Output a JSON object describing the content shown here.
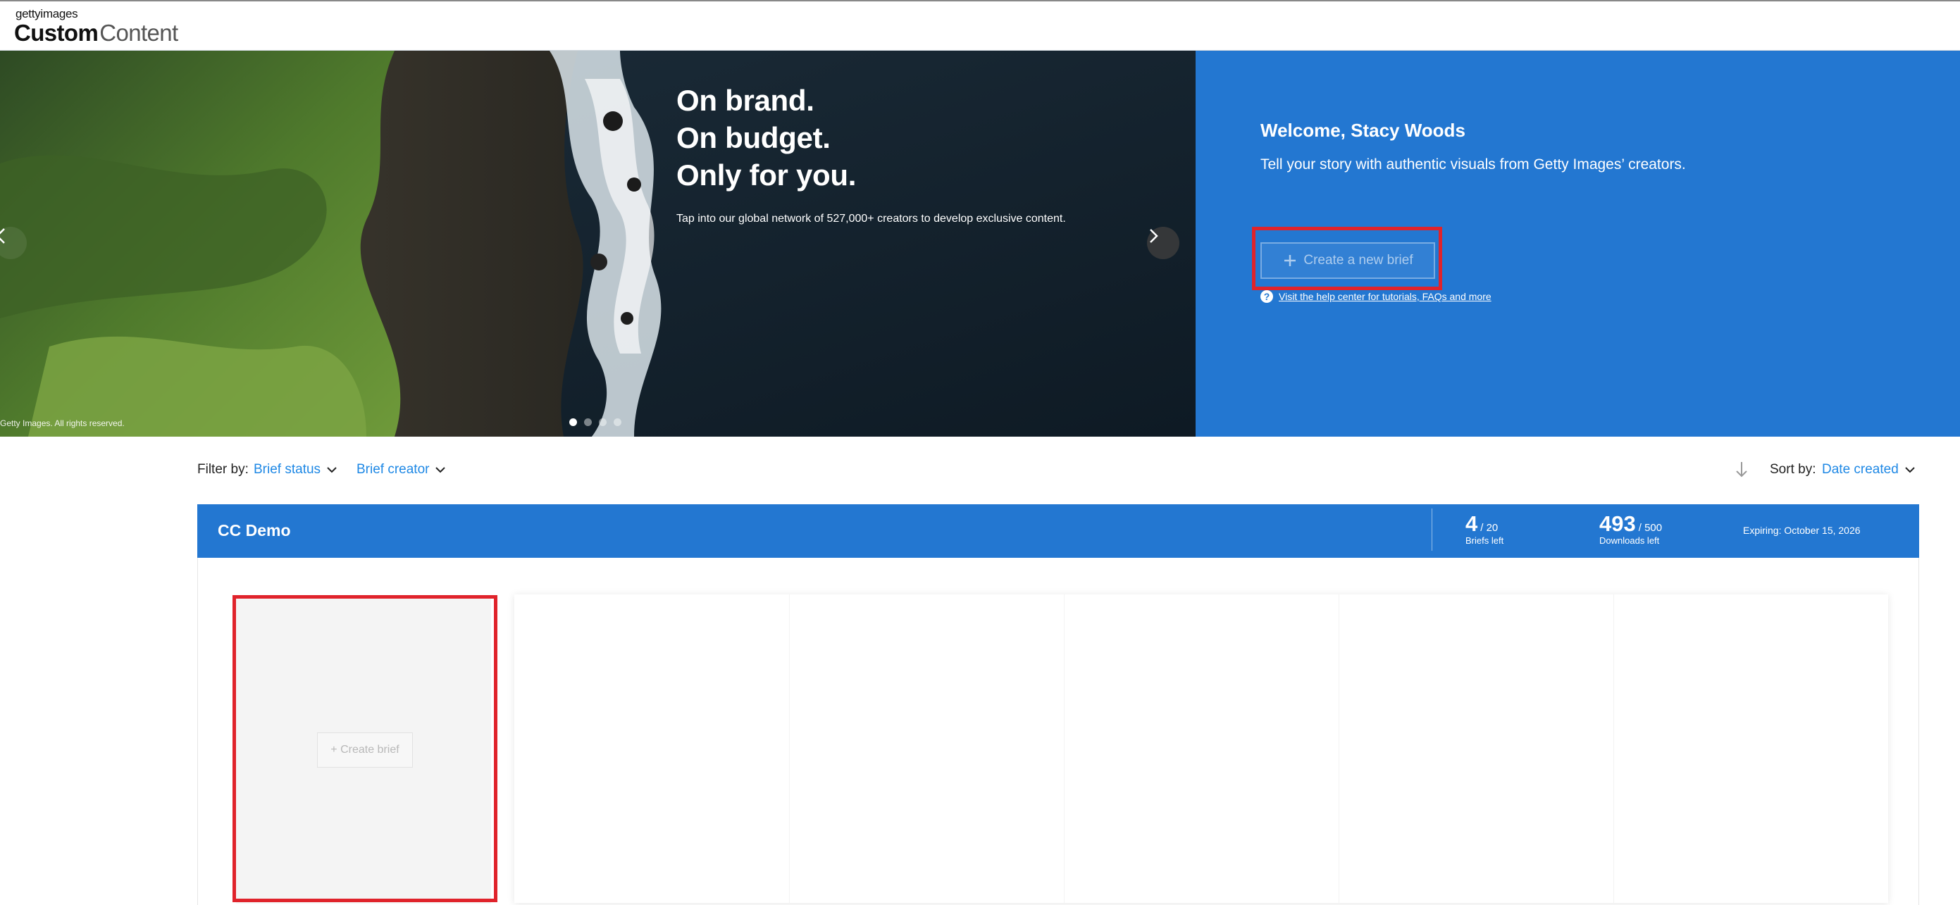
{
  "header": {
    "logo_brand": "gettyimages",
    "logo_title_part1": "Custom",
    "logo_title_part2": "Content"
  },
  "hero": {
    "headline_lines": [
      "On brand.",
      "On budget.",
      "Only for you."
    ],
    "tagline": "Tap into our global network of 527,000+ creators to develop exclusive content.",
    "copyright": "Getty Images. All rights reserved.",
    "welcome": "Welcome, Stacy Woods",
    "welcome_sub": "Tell your story with authentic visuals from Getty Images’ creators.",
    "create_button_label": "Create a new brief",
    "help_link": "Visit the help center for tutorials, FAQs and more"
  },
  "filters": {
    "filter_label": "Filter by:",
    "brief_status": "Brief status",
    "brief_creator": "Brief creator",
    "sort_label": "Sort by:",
    "sort_value": "Date created"
  },
  "account": {
    "name": "CC Demo",
    "briefs_left": "4",
    "briefs_total": "/ 20",
    "briefs_label": "Briefs left",
    "downloads_left": "493",
    "downloads_total": "/ 500",
    "downloads_label": "Downloads left",
    "expiry": "Expiring: October 15, 2026"
  },
  "content": {
    "create_brief_label": "+ Create brief"
  },
  "colors": {
    "accent_blue": "#2377d1",
    "link_blue": "#1e88e5",
    "highlight_red": "#e0232b"
  },
  "icons": {
    "prev": "chevron-left-icon",
    "next": "chevron-right-icon",
    "plus": "plus-icon",
    "help": "question-circle-icon",
    "dropdown": "chevron-down-icon",
    "sort": "arrow-down-icon"
  }
}
